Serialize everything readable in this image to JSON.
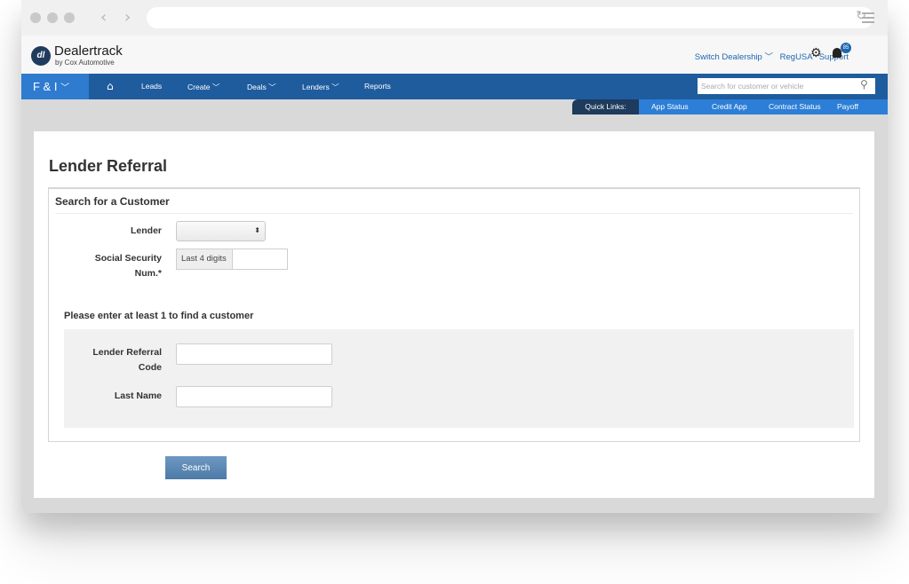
{
  "brand": {
    "name": "Dealertrack",
    "subtitle": "by Cox Automotive",
    "logo_text": "dl"
  },
  "toplinks": {
    "switch_dealership": "Switch Dealership",
    "regusa": "RegUSA",
    "support": "Support",
    "notification_count": "85"
  },
  "mainnav": {
    "module": "F & I",
    "items": [
      "Leads",
      "Create",
      "Deals",
      "Lenders",
      "Reports"
    ],
    "search_placeholder": "Search for customer or vehicle"
  },
  "quicklinks": {
    "label": "Quick Links:",
    "items": [
      "App Status",
      "Credit App",
      "Contract Status",
      "Payoff"
    ]
  },
  "page": {
    "title": "Lender Referral",
    "panel_title": "Search for a Customer",
    "lender_label": "Lender",
    "lender_value": "",
    "ssn_label_line1": "Social Security",
    "ssn_label_line2": "Num.*",
    "ssn_addon": "Last 4 digits",
    "ssn_value": "",
    "hint": "Please enter at least 1 to find a customer",
    "referral_label_line1": "Lender Referral",
    "referral_label_line2": "Code",
    "referral_value": "",
    "lastname_label": "Last Name",
    "lastname_value": "",
    "search_button": "Search"
  },
  "colors": {
    "nav_blue": "#1f5c9e",
    "module_blue": "#2f7bcf",
    "quicklinks_blue": "#2c7ed6",
    "quicklinks_label": "#1e3a5c",
    "link_blue": "#1f66b0",
    "button_blue": "#5b87b4"
  }
}
